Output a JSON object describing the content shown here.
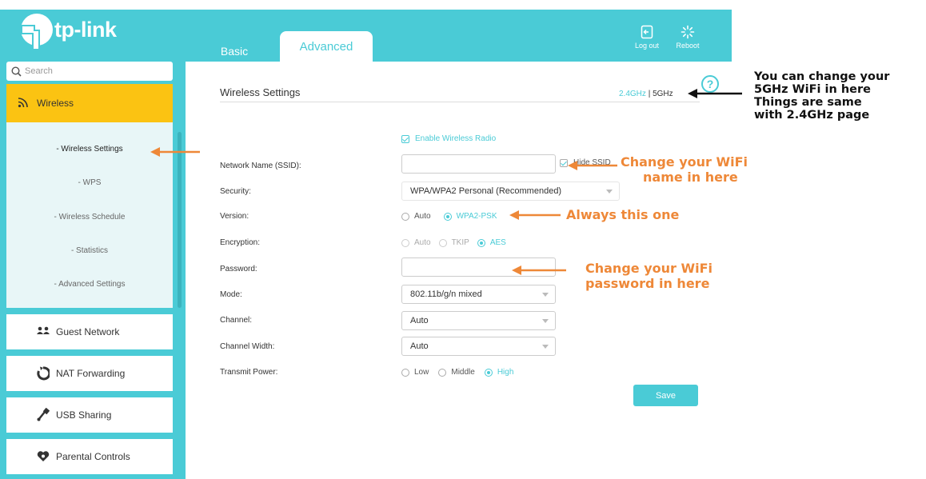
{
  "header": {
    "logo_text": "tp-link",
    "tabs": [
      {
        "label": "Basic"
      },
      {
        "label": "Advanced"
      }
    ],
    "logout_label": "Log out",
    "reboot_label": "Reboot"
  },
  "sidebar": {
    "search_placeholder": "Search",
    "wireless": {
      "label": "Wireless",
      "subitems": [
        {
          "label": "- Wireless Settings"
        },
        {
          "label": "- WPS"
        },
        {
          "label": "- Wireless Schedule"
        },
        {
          "label": "- Statistics"
        },
        {
          "label": "- Advanced Settings"
        }
      ]
    },
    "items": [
      {
        "label": "Guest Network",
        "icon": "guest-network-icon"
      },
      {
        "label": "NAT Forwarding",
        "icon": "nat-forwarding-icon"
      },
      {
        "label": "USB Sharing",
        "icon": "usb-sharing-icon"
      },
      {
        "label": "Parental Controls",
        "icon": "parental-controls-icon"
      }
    ]
  },
  "main": {
    "title": "Wireless Settings",
    "band_24": "2.4GHz",
    "band_sep": "|",
    "band_5": "5GHz",
    "help_label": "?",
    "enable_radio": "Enable Wireless Radio",
    "hide_ssid": "Hide SSID",
    "fields": {
      "ssid_label": "Network Name (SSID):",
      "ssid_value": "",
      "security_label": "Security:",
      "security_value": "WPA/WPA2 Personal (Recommended)",
      "version_label": "Version:",
      "version_options": [
        "Auto",
        "WPA2-PSK"
      ],
      "encryption_label": "Encryption:",
      "encryption_options": [
        "Auto",
        "TKIP",
        "AES"
      ],
      "password_label": "Password:",
      "password_value": "",
      "mode_label": "Mode:",
      "mode_value": "802.11b/g/n mixed",
      "channel_label": "Channel:",
      "channel_value": "Auto",
      "width_label": "Channel Width:",
      "width_value": "Auto",
      "power_label": "Transmit Power:",
      "power_options": [
        "Low",
        "Middle",
        "High"
      ]
    },
    "save_label": "Save"
  },
  "annotations": {
    "band_note": [
      "You can change your",
      "5GHz WiFi in here",
      "Things are same",
      "with 2.4GHz page"
    ],
    "ssid_note": [
      "Change your WiFi",
      "name in here"
    ],
    "version_note": "Always this one",
    "password_note": [
      "Change your WiFi",
      "password in here"
    ]
  },
  "colors": {
    "brand": "#4acbd6",
    "active_menu": "#fbc312",
    "annotation": "#ee8838"
  }
}
